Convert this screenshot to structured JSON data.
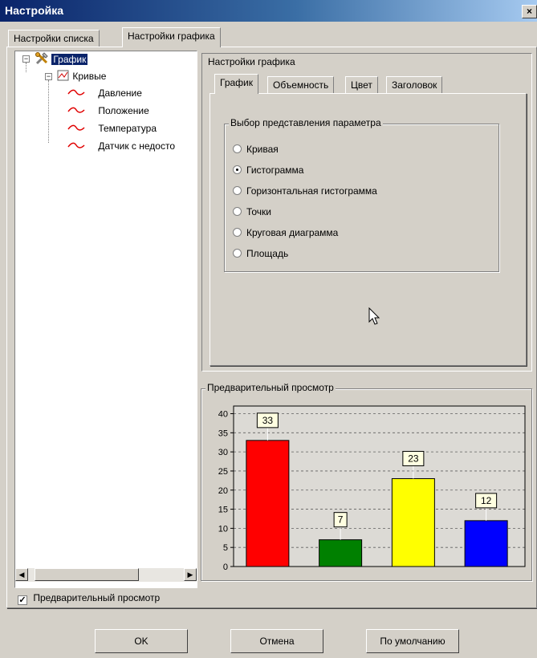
{
  "window": {
    "title": "Настройка",
    "close_icon": "close-icon"
  },
  "outer_tabs": [
    {
      "label": "Настройки списка",
      "active": false
    },
    {
      "label": "Настройки графика",
      "active": true
    }
  ],
  "tree": {
    "root": {
      "label": "График",
      "icon": "tools-icon",
      "expander": "−"
    },
    "curves": {
      "label": "Кривые",
      "icon": "chart-line-icon",
      "expander": "−"
    },
    "items": [
      {
        "label": "Давление",
        "icon": "curve-icon"
      },
      {
        "label": "Положение",
        "icon": "curve-icon"
      },
      {
        "label": "Температура",
        "icon": "curve-icon"
      },
      {
        "label": "Датчик с недосто",
        "icon": "curve-icon"
      }
    ]
  },
  "settings": {
    "title": "Настройки графика",
    "tabs": [
      {
        "label": "График",
        "active": true
      },
      {
        "label": "Объемность",
        "active": false
      },
      {
        "label": "Цвет",
        "active": false
      },
      {
        "label": "Заголовок",
        "active": false
      }
    ],
    "group_label": "Выбор представления параметра",
    "options": [
      {
        "label": "Кривая",
        "selected": false
      },
      {
        "label": "Гистограмма",
        "selected": true
      },
      {
        "label": "Горизонтальная гистограмма",
        "selected": false
      },
      {
        "label": "Точки",
        "selected": false
      },
      {
        "label": "Круговая диаграмма",
        "selected": false
      },
      {
        "label": "Площадь",
        "selected": false
      }
    ]
  },
  "preview": {
    "label": "Предварительный просмотр"
  },
  "preview_checkbox": {
    "label": "Предварительный просмотр",
    "checked": true
  },
  "buttons": {
    "ok": "OK",
    "cancel": "Отмена",
    "default": "По умолчанию"
  },
  "chart_data": {
    "type": "bar",
    "categories": [
      "",
      "",
      "",
      ""
    ],
    "values": [
      33,
      7,
      23,
      12
    ],
    "colors": [
      "#ff0000",
      "#008000",
      "#ffff00",
      "#0000ff"
    ],
    "data_labels": [
      "33",
      "7",
      "23",
      "12"
    ],
    "ylim": [
      0,
      42
    ],
    "yticks": [
      0,
      5,
      10,
      15,
      20,
      25,
      30,
      35,
      40
    ],
    "grid": true
  }
}
